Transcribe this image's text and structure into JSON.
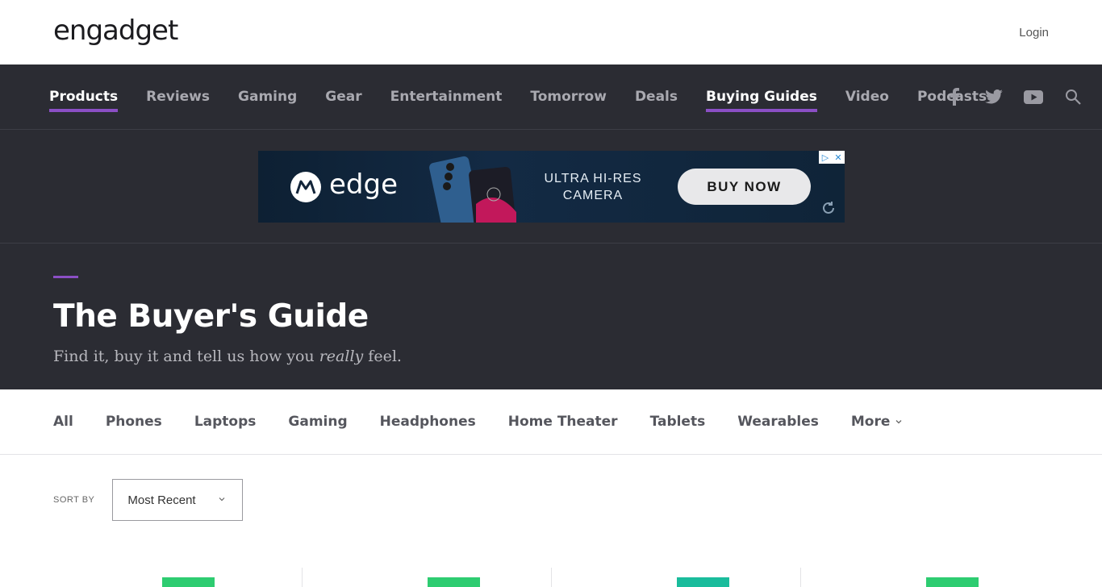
{
  "header": {
    "logo": "engadget",
    "login": "Login"
  },
  "nav": {
    "items": [
      {
        "label": "Products",
        "active": true
      },
      {
        "label": "Reviews",
        "active": false
      },
      {
        "label": "Gaming",
        "active": false
      },
      {
        "label": "Gear",
        "active": false
      },
      {
        "label": "Entertainment",
        "active": false
      },
      {
        "label": "Tomorrow",
        "active": false
      },
      {
        "label": "Deals",
        "active": false
      },
      {
        "label": "Buying Guides",
        "active": true
      },
      {
        "label": "Video",
        "active": false
      },
      {
        "label": "Podcasts",
        "active": false
      }
    ],
    "social_icons": [
      "facebook-icon",
      "twitter-icon",
      "youtube-icon",
      "search-icon"
    ]
  },
  "ad": {
    "brand": "edge",
    "tagline_line1": "ULTRA HI-RES",
    "tagline_line2": "CAMERA",
    "cta": "BUY NOW"
  },
  "hero": {
    "title": "The Buyer's Guide",
    "subtitle_before": "Find it, buy it and tell us how you ",
    "subtitle_em": "really",
    "subtitle_after": " feel."
  },
  "categories": {
    "items": [
      "All",
      "Phones",
      "Laptops",
      "Gaming",
      "Headphones",
      "Home Theater",
      "Tablets",
      "Wearables"
    ],
    "more": "More"
  },
  "sort": {
    "label": "SORT BY",
    "selected": "Most Recent"
  },
  "colors": {
    "accent": "#8b4fc5",
    "nav_bg": "#2b2c33",
    "badge_green": "#2ecc71",
    "badge_teal": "#1abc9c"
  }
}
